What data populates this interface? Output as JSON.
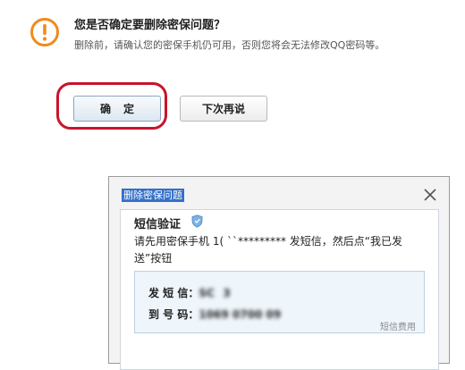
{
  "confirm": {
    "icon": "warning-circle-icon",
    "question": "您是否确定要删除密保问题？",
    "description": "删除前，请确认您的密保手机仍可用，否则您将会无法修改QQ密码等。",
    "ok_label": "确定",
    "later_label": "下次再说",
    "highlight_color": "#c8142b"
  },
  "sms_dialog": {
    "title": "删除密保问题",
    "close_icon": "close-x-icon",
    "heading": "短信验证",
    "heading_icon": "shield-icon",
    "instruction": "请先用密保手机 1( ``********* 发短信，然后点“我已发送”按钮",
    "send_label": "发 短 信：",
    "send_value": "SC    3",
    "number_label": "到 号 码：",
    "number_value": "1069 0700 09",
    "fee_link": "短信费用",
    "title_bg": "#3270c8"
  }
}
